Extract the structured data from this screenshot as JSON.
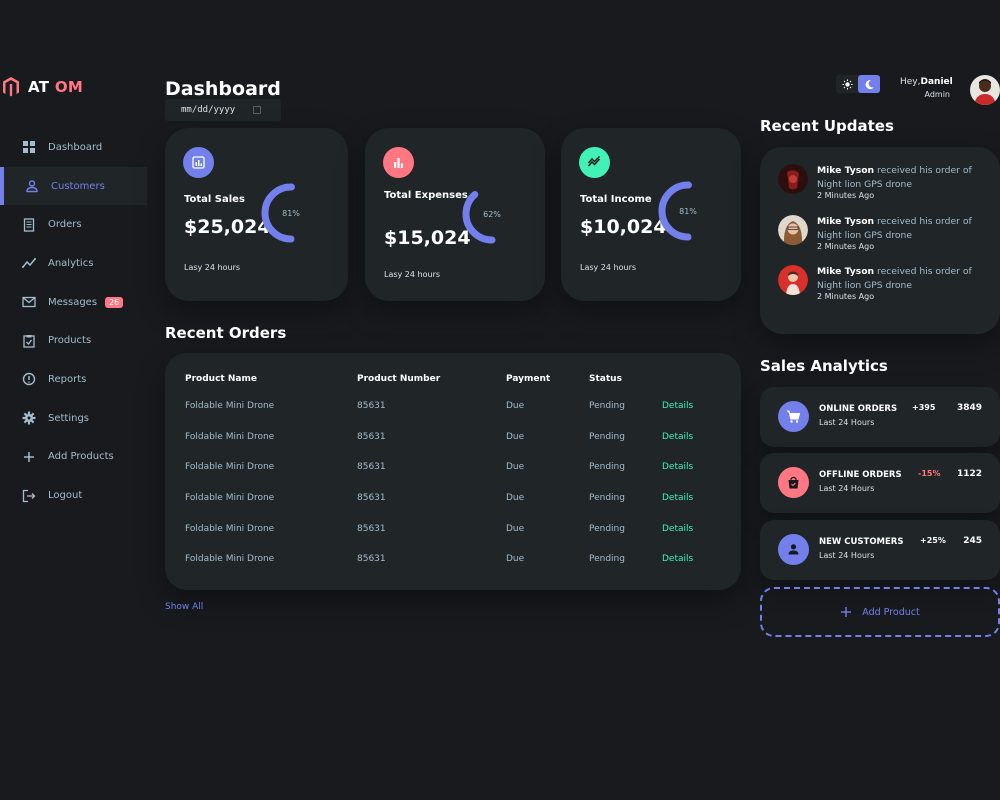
{
  "brand": {
    "part1": "AT",
    "part2": "OM"
  },
  "sidebar": {
    "items": [
      {
        "label": "Dashboard",
        "icon": "grid-icon"
      },
      {
        "label": "Customers",
        "icon": "person-icon",
        "active": true
      },
      {
        "label": "Orders",
        "icon": "receipt-icon"
      },
      {
        "label": "Analytics",
        "icon": "analytics-icon"
      },
      {
        "label": "Messages",
        "icon": "mail-icon",
        "badge": "26"
      },
      {
        "label": "Products",
        "icon": "inventory-icon"
      },
      {
        "label": "Reports",
        "icon": "report-icon"
      },
      {
        "label": "Settings",
        "icon": "gear-icon"
      },
      {
        "label": "Add Products",
        "icon": "plus-icon"
      },
      {
        "label": "Logout",
        "icon": "logout-icon"
      }
    ]
  },
  "header": {
    "title": "Dashboard",
    "date_placeholder": "mm/dd/yyyy"
  },
  "cards": [
    {
      "label": "Total Sales",
      "value": "$25,024",
      "percent": "81%",
      "progress": 0.81,
      "foot": "Lasy 24 hours",
      "color": "#7380ec",
      "icon": "analytics-icon"
    },
    {
      "label": "Total Expenses",
      "value": "$15,024",
      "percent": "62%",
      "progress": 0.62,
      "foot": "Lasy 24 hours",
      "color": "#ff7782",
      "icon": "bar-chart-icon"
    },
    {
      "label": "Total Income",
      "value": "$10,024",
      "percent": "81%",
      "progress": 0.81,
      "foot": "Lasy 24 hours",
      "color": "#41f1b6",
      "icon": "stocks-icon"
    }
  ],
  "recent_orders": {
    "title": "Recent Orders",
    "columns": [
      "Product Name",
      "Product Number",
      "Payment",
      "Status",
      ""
    ],
    "rows": [
      [
        "Foldable Mini Drone",
        "85631",
        "Due",
        "Pending",
        "Details"
      ],
      [
        "Foldable Mini Drone",
        "85631",
        "Due",
        "Pending",
        "Details"
      ],
      [
        "Foldable Mini Drone",
        "85631",
        "Due",
        "Pending",
        "Details"
      ],
      [
        "Foldable Mini Drone",
        "85631",
        "Due",
        "Pending",
        "Details"
      ],
      [
        "Foldable Mini Drone",
        "85631",
        "Due",
        "Pending",
        "Details"
      ],
      [
        "Foldable Mini Drone",
        "85631",
        "Due",
        "Pending",
        "Details"
      ]
    ],
    "show_all": "Show All"
  },
  "profile": {
    "greeting": "Hey,",
    "name": "Daniel",
    "role": "Admin"
  },
  "recent_updates": {
    "title": "Recent Updates",
    "items": [
      {
        "name": "Mike Tyson",
        "text": " received his order of Night lion GPS drone",
        "time": "2 Minutes Ago",
        "avatar_color": "#8a1c1c"
      },
      {
        "name": "Mike Tyson",
        "text": " received his order of Night lion GPS drone",
        "time": "2 Minutes Ago",
        "avatar_color": "#c99a7e"
      },
      {
        "name": "Mike Tyson",
        "text": " received his order of Night lion GPS drone",
        "time": "2 Minutes Ago",
        "avatar_color": "#d9302b"
      }
    ]
  },
  "sales_analytics": {
    "title": "Sales Analytics",
    "items": [
      {
        "title": "ONLINE ORDERS",
        "sub": "Last 24 Hours",
        "pct": "+395",
        "num": "3849",
        "color": "#7380ec",
        "pct_color": "#ffffff",
        "icon": "cart-icon"
      },
      {
        "title": "OFFLINE ORDERS",
        "sub": "Last 24 Hours",
        "pct": "-15%",
        "num": "1122",
        "color": "#ff7782",
        "pct_color": "#ff7782",
        "icon": "bag-icon"
      },
      {
        "title": "NEW CUSTOMERS",
        "sub": "Last 24 Hours",
        "pct": "+25%",
        "num": "245",
        "color": "#7380ec",
        "pct_color": "#ffffff",
        "icon": "person-icon"
      }
    ],
    "add_label": "Add Product"
  }
}
